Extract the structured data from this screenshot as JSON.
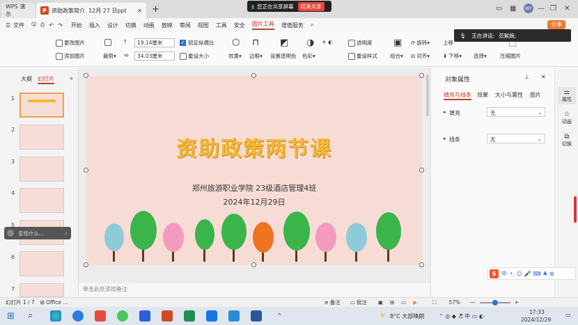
{
  "titlebar": {
    "app_tab": "WPS 演示",
    "doc_tab": "资助政策简介. 12月 27 日ppt",
    "share_status": "您正在共享屏幕",
    "share_stop": "结束共享",
    "user_initials": "WY"
  },
  "menu": {
    "file": "文件",
    "items": [
      "开始",
      "插入",
      "设计",
      "切换",
      "动画",
      "放映",
      "审阅",
      "视图",
      "工具",
      "安全",
      "图片工具",
      "增值服务"
    ],
    "active": "图片工具",
    "share": "分享"
  },
  "ribbon": {
    "change_pic": "更改图片",
    "add_pic": "添加图片",
    "crop": "裁剪",
    "width": "19.14厘米",
    "height": "34.03厘米",
    "lock_ratio": "锁定纵横比",
    "reset_size": "重设大小",
    "effects": "效果",
    "border": "边框",
    "set_transparent": "设置透明色",
    "color": "色彩",
    "transparency": "透明度",
    "reset_style": "重设样式",
    "group": "组合",
    "align": "对齐",
    "rotate": "旋转",
    "move_up": "上移",
    "move_down": "下移",
    "select": "选择",
    "compress": "压缩图片",
    "speaking": "正在讲话:",
    "speaker": "范絮婉;"
  },
  "left_panel": {
    "outline": "大纲",
    "slides": "幻灯片",
    "search_placeholder": "查找什么...",
    "numbers": [
      "1",
      "2",
      "3",
      "4",
      "5",
      "6",
      "7"
    ]
  },
  "slide": {
    "title": "资助政策两节课",
    "subtitle": "郑州旅游职业学院  23级酒店管理4班",
    "date": "2024年12月29日"
  },
  "notes": {
    "placeholder": "单击此处添加备注"
  },
  "right_panel": {
    "title": "对象属性",
    "tabs": [
      "填充与线条",
      "效果",
      "大小与属性",
      "图片"
    ],
    "fill": "填充",
    "fill_value": "无",
    "line": "线条",
    "line_value": "无"
  },
  "sidebar": {
    "properties": "属性",
    "animation": "动画",
    "transition": "切换"
  },
  "status": {
    "slide_count": "幻灯片 1 / 7",
    "theme": "Office ...",
    "notes": "备注",
    "comments": "批注",
    "zoom": "57%"
  },
  "taskbar": {
    "weather": "8°C 大部晴朗",
    "time": "17:33",
    "date": "2024/12/29",
    "ime": "中"
  }
}
